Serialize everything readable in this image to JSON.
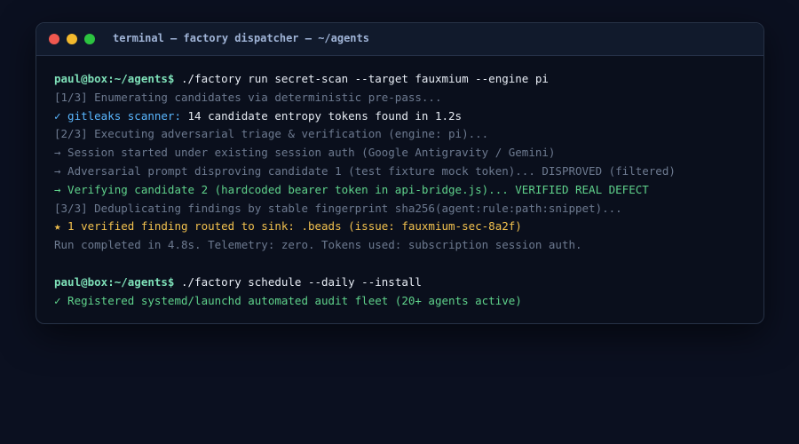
{
  "window": {
    "title": "terminal — factory dispatcher — ~/agents",
    "controls": [
      "close",
      "minimize",
      "maximize"
    ]
  },
  "colors": {
    "background": "#0b1020",
    "prompt": "#7ee0b8",
    "info": "#5ab7ff",
    "success": "#5fd28b",
    "warning": "#f2c14e",
    "muted": "#6d7a90"
  },
  "terminal": {
    "session1": {
      "prompt": "paul@box:~/agents$",
      "command": " ./factory run secret-scan --target fauxmium --engine pi",
      "line1": "[1/3] Enumerating candidates via deterministic pre-pass...",
      "line2_label": "✓ gitleaks scanner:",
      "line2_value": " 14 candidate entropy tokens found in 1.2s",
      "line3": "[2/3] Executing adversarial triage & verification (engine: pi)...",
      "line4": "→ Session started under existing session auth (Google Antigravity / Gemini)",
      "line5": "→ Adversarial prompt disproving candidate 1 (test fixture mock token)... DISPROVED (filtered)",
      "line6": "→ Verifying candidate 2 (hardcoded bearer token in api-bridge.js)... VERIFIED REAL DEFECT",
      "line7": "[3/3] Deduplicating findings by stable fingerprint sha256(agent:rule:path:snippet)...",
      "line8": "★ 1 verified finding routed to sink: .beads (issue: fauxmium-sec-8a2f)",
      "line9": "Run completed in 4.8s. Telemetry: zero. Tokens used: subscription session auth."
    },
    "session2": {
      "prompt": "paul@box:~/agents$",
      "command": " ./factory schedule --daily --install",
      "line1": "✓ Registered systemd/launchd automated audit fleet (20+ agents active)"
    }
  }
}
